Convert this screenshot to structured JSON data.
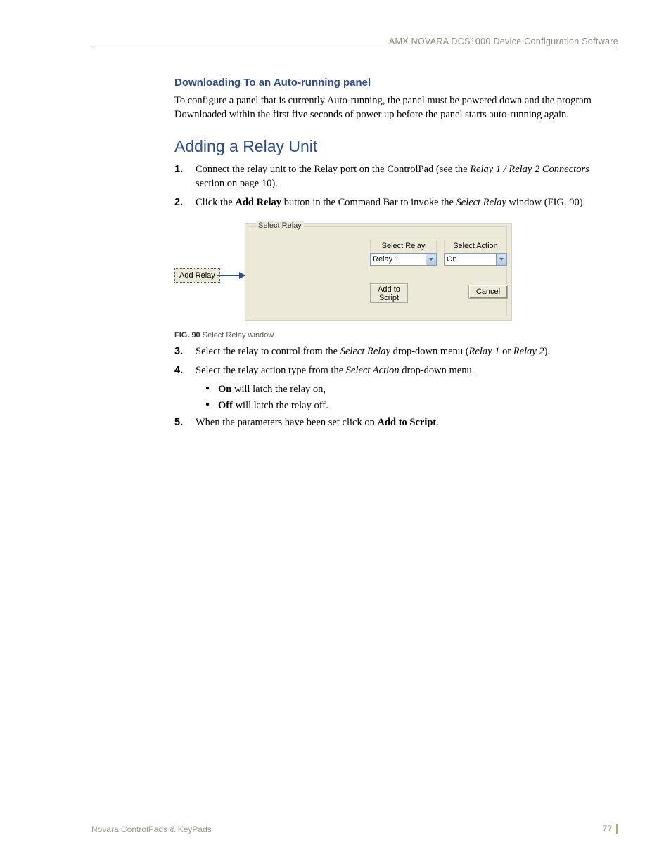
{
  "header": {
    "running_title": "AMX NOVARA DCS1000 Device Configuration Software"
  },
  "section1": {
    "heading": "Downloading To an Auto-running panel",
    "body": "To configure a panel that is currently Auto-running, the panel must be powered down and the program Downloaded within the first five seconds of power up before the panel starts auto-running again."
  },
  "section2": {
    "heading": "Adding a Relay Unit",
    "step1": {
      "pre": "Connect the relay unit to the Relay port on the ControlPad (see the ",
      "em": "Relay 1 / Relay 2 Connectors",
      "post": " section on page 10)."
    },
    "step2": {
      "pre": "Click the ",
      "b1": "Add Relay",
      "mid": " button in the Command Bar to invoke the ",
      "em": "Select Relay",
      "post": " window (FIG. 90)."
    },
    "step3": {
      "pre": "Select the relay to control from the ",
      "em1": "Select Relay",
      "mid": " drop-down menu (",
      "em2": "Relay 1",
      "or": " or ",
      "em3": "Relay 2",
      "post": ")."
    },
    "step4": {
      "pre": "Select the relay action type from the ",
      "em": "Select Action",
      "post": " drop-down menu."
    },
    "bullet_on": {
      "b": "On",
      "rest": " will latch the relay on,"
    },
    "bullet_off": {
      "b": "Off",
      "rest": " will latch the relay off."
    },
    "step5": {
      "pre": "When the parameters have been set click on ",
      "b": "Add to Script",
      "post": "."
    }
  },
  "figure": {
    "add_relay_btn": "Add Relay",
    "group_label": "Select Relay",
    "select_relay_label": "Select Relay",
    "select_relay_value": "Relay 1",
    "select_action_label": "Select Action",
    "select_action_value": "On",
    "add_to_script": "Add to\nScript",
    "cancel": "Cancel"
  },
  "fig_caption": {
    "bold": "FIG. 90",
    "rest": "  Select Relay window"
  },
  "footer": {
    "left": "Novara ControlPads & KeyPads",
    "page": "77"
  },
  "markers": {
    "m1": "1.",
    "m2": "2.",
    "m3": "3.",
    "m4": "4.",
    "m5": "5."
  }
}
